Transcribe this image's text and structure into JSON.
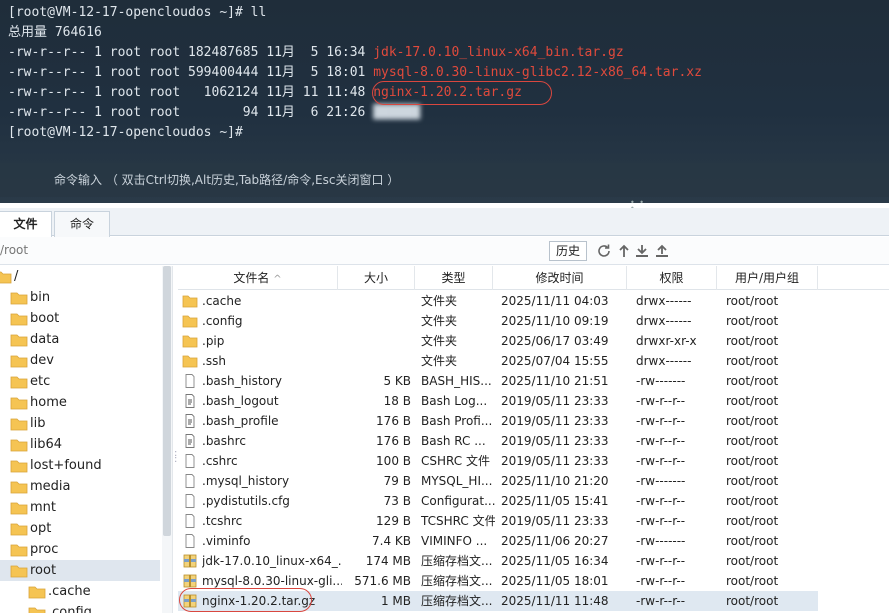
{
  "terminal": {
    "prompt_line_1": "[root@VM-12-17-opencloudos ~]# ll",
    "total_line": "总用量 764616",
    "entries": [
      {
        "meta": "-rw-r--r-- 1 root root 182487685 11月  5 16:34 ",
        "name": "jdk-17.0.10_linux-x64_bin.tar.gz",
        "color": "#e04a3c"
      },
      {
        "meta": "-rw-r--r-- 1 root root 599400444 11月  5 18:01 ",
        "name": "mysql-8.0.30-linux-glibc2.12-x86_64.tar.xz",
        "color": "#e04a3c"
      },
      {
        "meta": "-rw-r--r-- 1 root root   1062124 11月 11 11:48 ",
        "name": "nginx-1.20.2.tar.gz",
        "color": "#e04a3c"
      },
      {
        "meta": "-rw-r--r-- 1 root root        94 11月  6 21:26 ",
        "name": "██████",
        "color": "#cdd6de"
      }
    ],
    "prompt_line_2": "[root@VM-12-17-opencloudos ~]#",
    "command_input_hint": "命令输入 （ 双击Ctrl切换,Alt历史,Tab路径/命令,Esc关闭窗口 ）",
    "highlight_color": "#d9473f"
  },
  "tabs": [
    {
      "label": "文件",
      "active": true
    },
    {
      "label": "命令",
      "active": false
    }
  ],
  "toolbar": {
    "path": "/root",
    "history_label": "历史",
    "icons": [
      "refresh-icon",
      "upload-folder-icon",
      "download-icon",
      "upload-icon"
    ]
  },
  "tree": {
    "items": [
      {
        "label": "/",
        "level": 0
      },
      {
        "label": "bin",
        "level": 1
      },
      {
        "label": "boot",
        "level": 1
      },
      {
        "label": "data",
        "level": 1
      },
      {
        "label": "dev",
        "level": 1
      },
      {
        "label": "etc",
        "level": 1
      },
      {
        "label": "home",
        "level": 1
      },
      {
        "label": "lib",
        "level": 1
      },
      {
        "label": "lib64",
        "level": 1
      },
      {
        "label": "lost+found",
        "level": 1
      },
      {
        "label": "media",
        "level": 1
      },
      {
        "label": "mnt",
        "level": 1
      },
      {
        "label": "opt",
        "level": 1
      },
      {
        "label": "proc",
        "level": 1
      },
      {
        "label": "root",
        "level": 1,
        "selected": true
      },
      {
        "label": ".cache",
        "level": 2
      },
      {
        "label": ".config",
        "level": 2
      }
    ]
  },
  "files": {
    "columns": [
      "文件名",
      "大小",
      "类型",
      "修改时间",
      "权限",
      "用户/用户组"
    ],
    "sort_indicator": "^",
    "rows": [
      {
        "name": ".cache",
        "size": "",
        "type": "文件夹",
        "mtime": "2025/11/11 04:03",
        "perm": "drwx------",
        "owner": "root/root",
        "icon": "folder"
      },
      {
        "name": ".config",
        "size": "",
        "type": "文件夹",
        "mtime": "2025/11/10 09:19",
        "perm": "drwx------",
        "owner": "root/root",
        "icon": "folder"
      },
      {
        "name": ".pip",
        "size": "",
        "type": "文件夹",
        "mtime": "2025/06/17 03:49",
        "perm": "drwxr-xr-x",
        "owner": "root/root",
        "icon": "folder"
      },
      {
        "name": ".ssh",
        "size": "",
        "type": "文件夹",
        "mtime": "2025/07/04 15:55",
        "perm": "drwx------",
        "owner": "root/root",
        "icon": "folder"
      },
      {
        "name": ".bash_history",
        "size": "5 KB",
        "type": "BASH_HIS...",
        "mtime": "2025/11/10 21:51",
        "perm": "-rw-------",
        "owner": "root/root",
        "icon": "file"
      },
      {
        "name": ".bash_logout",
        "size": "18 B",
        "type": "Bash Log...",
        "mtime": "2019/05/11 23:33",
        "perm": "-rw-r--r--",
        "owner": "root/root",
        "icon": "script"
      },
      {
        "name": ".bash_profile",
        "size": "176 B",
        "type": "Bash Profi...",
        "mtime": "2019/05/11 23:33",
        "perm": "-rw-r--r--",
        "owner": "root/root",
        "icon": "script"
      },
      {
        "name": ".bashrc",
        "size": "176 B",
        "type": "Bash RC ...",
        "mtime": "2019/05/11 23:33",
        "perm": "-rw-r--r--",
        "owner": "root/root",
        "icon": "script"
      },
      {
        "name": ".cshrc",
        "size": "100 B",
        "type": "CSHRC 文件",
        "mtime": "2019/05/11 23:33",
        "perm": "-rw-r--r--",
        "owner": "root/root",
        "icon": "file"
      },
      {
        "name": ".mysql_history",
        "size": "79 B",
        "type": "MYSQL_HI...",
        "mtime": "2025/11/10 21:20",
        "perm": "-rw-------",
        "owner": "root/root",
        "icon": "file"
      },
      {
        "name": ".pydistutils.cfg",
        "size": "73 B",
        "type": "Configurat...",
        "mtime": "2025/11/05 15:41",
        "perm": "-rw-r--r--",
        "owner": "root/root",
        "icon": "file"
      },
      {
        "name": ".tcshrc",
        "size": "129 B",
        "type": "TCSHRC 文件",
        "mtime": "2019/05/11 23:33",
        "perm": "-rw-r--r--",
        "owner": "root/root",
        "icon": "file"
      },
      {
        "name": ".viminfo",
        "size": "7.4 KB",
        "type": "VIMINFO ...",
        "mtime": "2025/11/06 20:27",
        "perm": "-rw-------",
        "owner": "root/root",
        "icon": "file"
      },
      {
        "name": "jdk-17.0.10_linux-x64_...",
        "size": "174 MB",
        "type": "压缩存档文...",
        "mtime": "2025/11/05 16:34",
        "perm": "-rw-r--r--",
        "owner": "root/root",
        "icon": "archive"
      },
      {
        "name": "mysql-8.0.30-linux-gli...",
        "size": "571.6 MB",
        "type": "压缩存档文...",
        "mtime": "2025/11/05 18:01",
        "perm": "-rw-r--r--",
        "owner": "root/root",
        "icon": "archive"
      },
      {
        "name": "nginx-1.20.2.tar.gz",
        "size": "1 MB",
        "type": "压缩存档文...",
        "mtime": "2025/11/11 11:48",
        "perm": "-rw-r--r--",
        "owner": "root/root",
        "icon": "archive",
        "selected": true
      }
    ]
  }
}
